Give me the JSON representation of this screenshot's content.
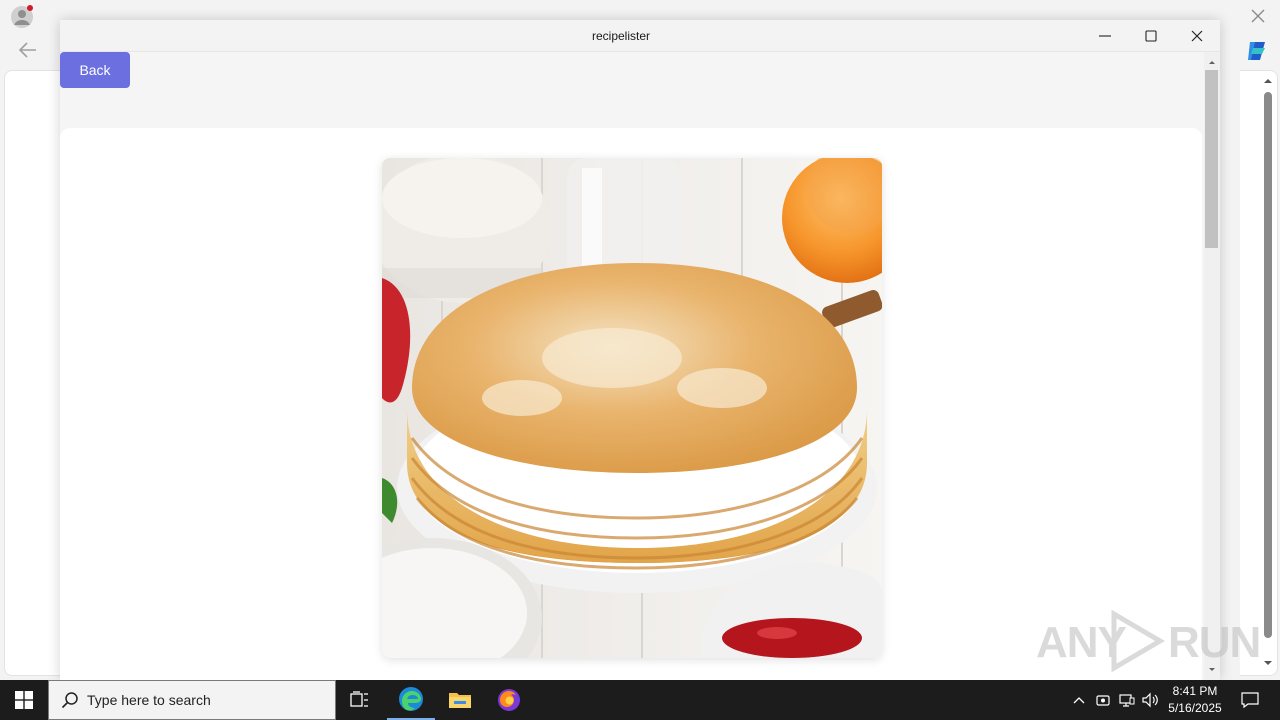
{
  "app": {
    "title": "recipelister",
    "back_label": "Back"
  },
  "recipe": {
    "image_subject": "stack-of-crepes-photo"
  },
  "watermark": {
    "text_left": "ANY",
    "text_right": "RUN"
  },
  "taskbar": {
    "search_placeholder": "Type here to search",
    "time": "8:41 PM",
    "date": "5/16/2025"
  },
  "colors": {
    "accent": "#6c6fdf",
    "taskbar": "#1c1c1c"
  }
}
